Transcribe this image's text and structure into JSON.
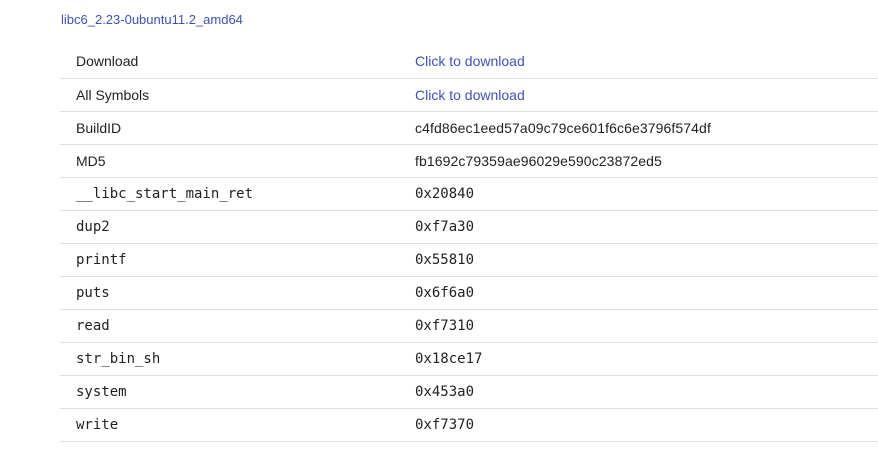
{
  "library": {
    "name": "libc6_2.23-0ubuntu11.2_amd64"
  },
  "rows": {
    "download": {
      "label": "Download",
      "value": "Click to download"
    },
    "all_symbols": {
      "label": "All Symbols",
      "value": "Click to download"
    },
    "buildid": {
      "label": "BuildID",
      "value": "c4fd86ec1eed57a09c79ce601f6c6e3796f574df"
    },
    "md5": {
      "label": "MD5",
      "value": "fb1692c79359ae96029e590c23872ed5"
    }
  },
  "symbols": [
    {
      "name": "__libc_start_main_ret",
      "offset": "0x20840"
    },
    {
      "name": "dup2",
      "offset": "0xf7a30"
    },
    {
      "name": "printf",
      "offset": "0x55810"
    },
    {
      "name": "puts",
      "offset": "0x6f6a0"
    },
    {
      "name": "read",
      "offset": "0xf7310"
    },
    {
      "name": "str_bin_sh",
      "offset": "0x18ce17"
    },
    {
      "name": "system",
      "offset": "0x453a0"
    },
    {
      "name": "write",
      "offset": "0xf7370"
    }
  ],
  "colors": {
    "link": "#3f51b5",
    "row_divider": "#e0e0e0",
    "text": "#222222"
  }
}
